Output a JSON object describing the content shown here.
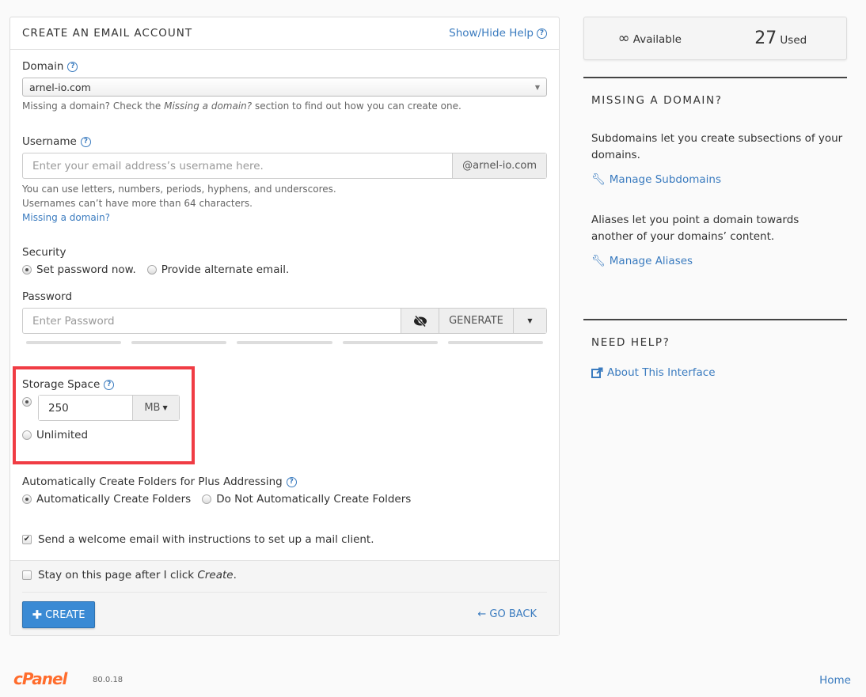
{
  "form": {
    "title": "CREATE AN EMAIL ACCOUNT",
    "help_toggle": "Show/Hide Help",
    "domain": {
      "label": "Domain",
      "value": "arnel-io.com",
      "hint_prefix": "Missing a domain? Check the ",
      "hint_em": "Missing a domain?",
      "hint_suffix": " section to find out how you can create one."
    },
    "username": {
      "label": "Username",
      "placeholder": "Enter your email address’s username here.",
      "value": "",
      "suffix": "@arnel-io.com",
      "hint_line1": "You can use letters, numbers, periods, hyphens, and underscores.",
      "hint_line2": "Usernames can’t have more than 64 characters.",
      "missing_link": "Missing a domain?"
    },
    "security": {
      "label": "Security",
      "options": [
        {
          "label": "Set password now.",
          "selected": true
        },
        {
          "label": "Provide alternate email.",
          "selected": false
        }
      ]
    },
    "password": {
      "label": "Password",
      "placeholder": "Enter Password",
      "value": "",
      "toggle_icon": "eye-slash-icon",
      "generate_label": "GENERATE",
      "strength_segments_filled": 0,
      "strength_segments_total": 5
    },
    "storage": {
      "label": "Storage Space",
      "value": "250",
      "unit": "MB",
      "unlimited_label": "Unlimited",
      "selected": "custom"
    },
    "plus_addressing": {
      "label": "Automatically Create Folders for Plus Addressing",
      "options": [
        {
          "label": "Automatically Create Folders",
          "selected": true
        },
        {
          "label": "Do Not Automatically Create Folders",
          "selected": false
        }
      ]
    },
    "welcome_email": {
      "label": "Send a welcome email with instructions to set up a mail client.",
      "checked": true
    },
    "stay_on_page": {
      "label_prefix": "Stay on this page after I click ",
      "label_em": "Create",
      "label_suffix": ".",
      "checked": false
    },
    "create_label": "CREATE",
    "go_back_label": "GO BACK"
  },
  "stats": {
    "available_value": "∞",
    "available_label": "Available",
    "used_value": "27",
    "used_label": "Used"
  },
  "sidebar": {
    "missing_title": "MISSING A DOMAIN?",
    "subdomains_text": "Subdomains let you create subsections of your domains.",
    "subdomains_link": "Manage Subdomains",
    "aliases_text": "Aliases let you point a domain towards another of your domains’ content.",
    "aliases_link": "Manage Aliases",
    "help_title": "NEED HELP?",
    "about_link": "About This Interface"
  },
  "footer": {
    "brand": "cPanel",
    "version": "80.0.18",
    "home_link": "Home"
  },
  "colors": {
    "accent": "#3a7bbf",
    "primary_button": "#3a8ad4",
    "highlight": "#f03c44",
    "brand": "#ff6c2c"
  }
}
